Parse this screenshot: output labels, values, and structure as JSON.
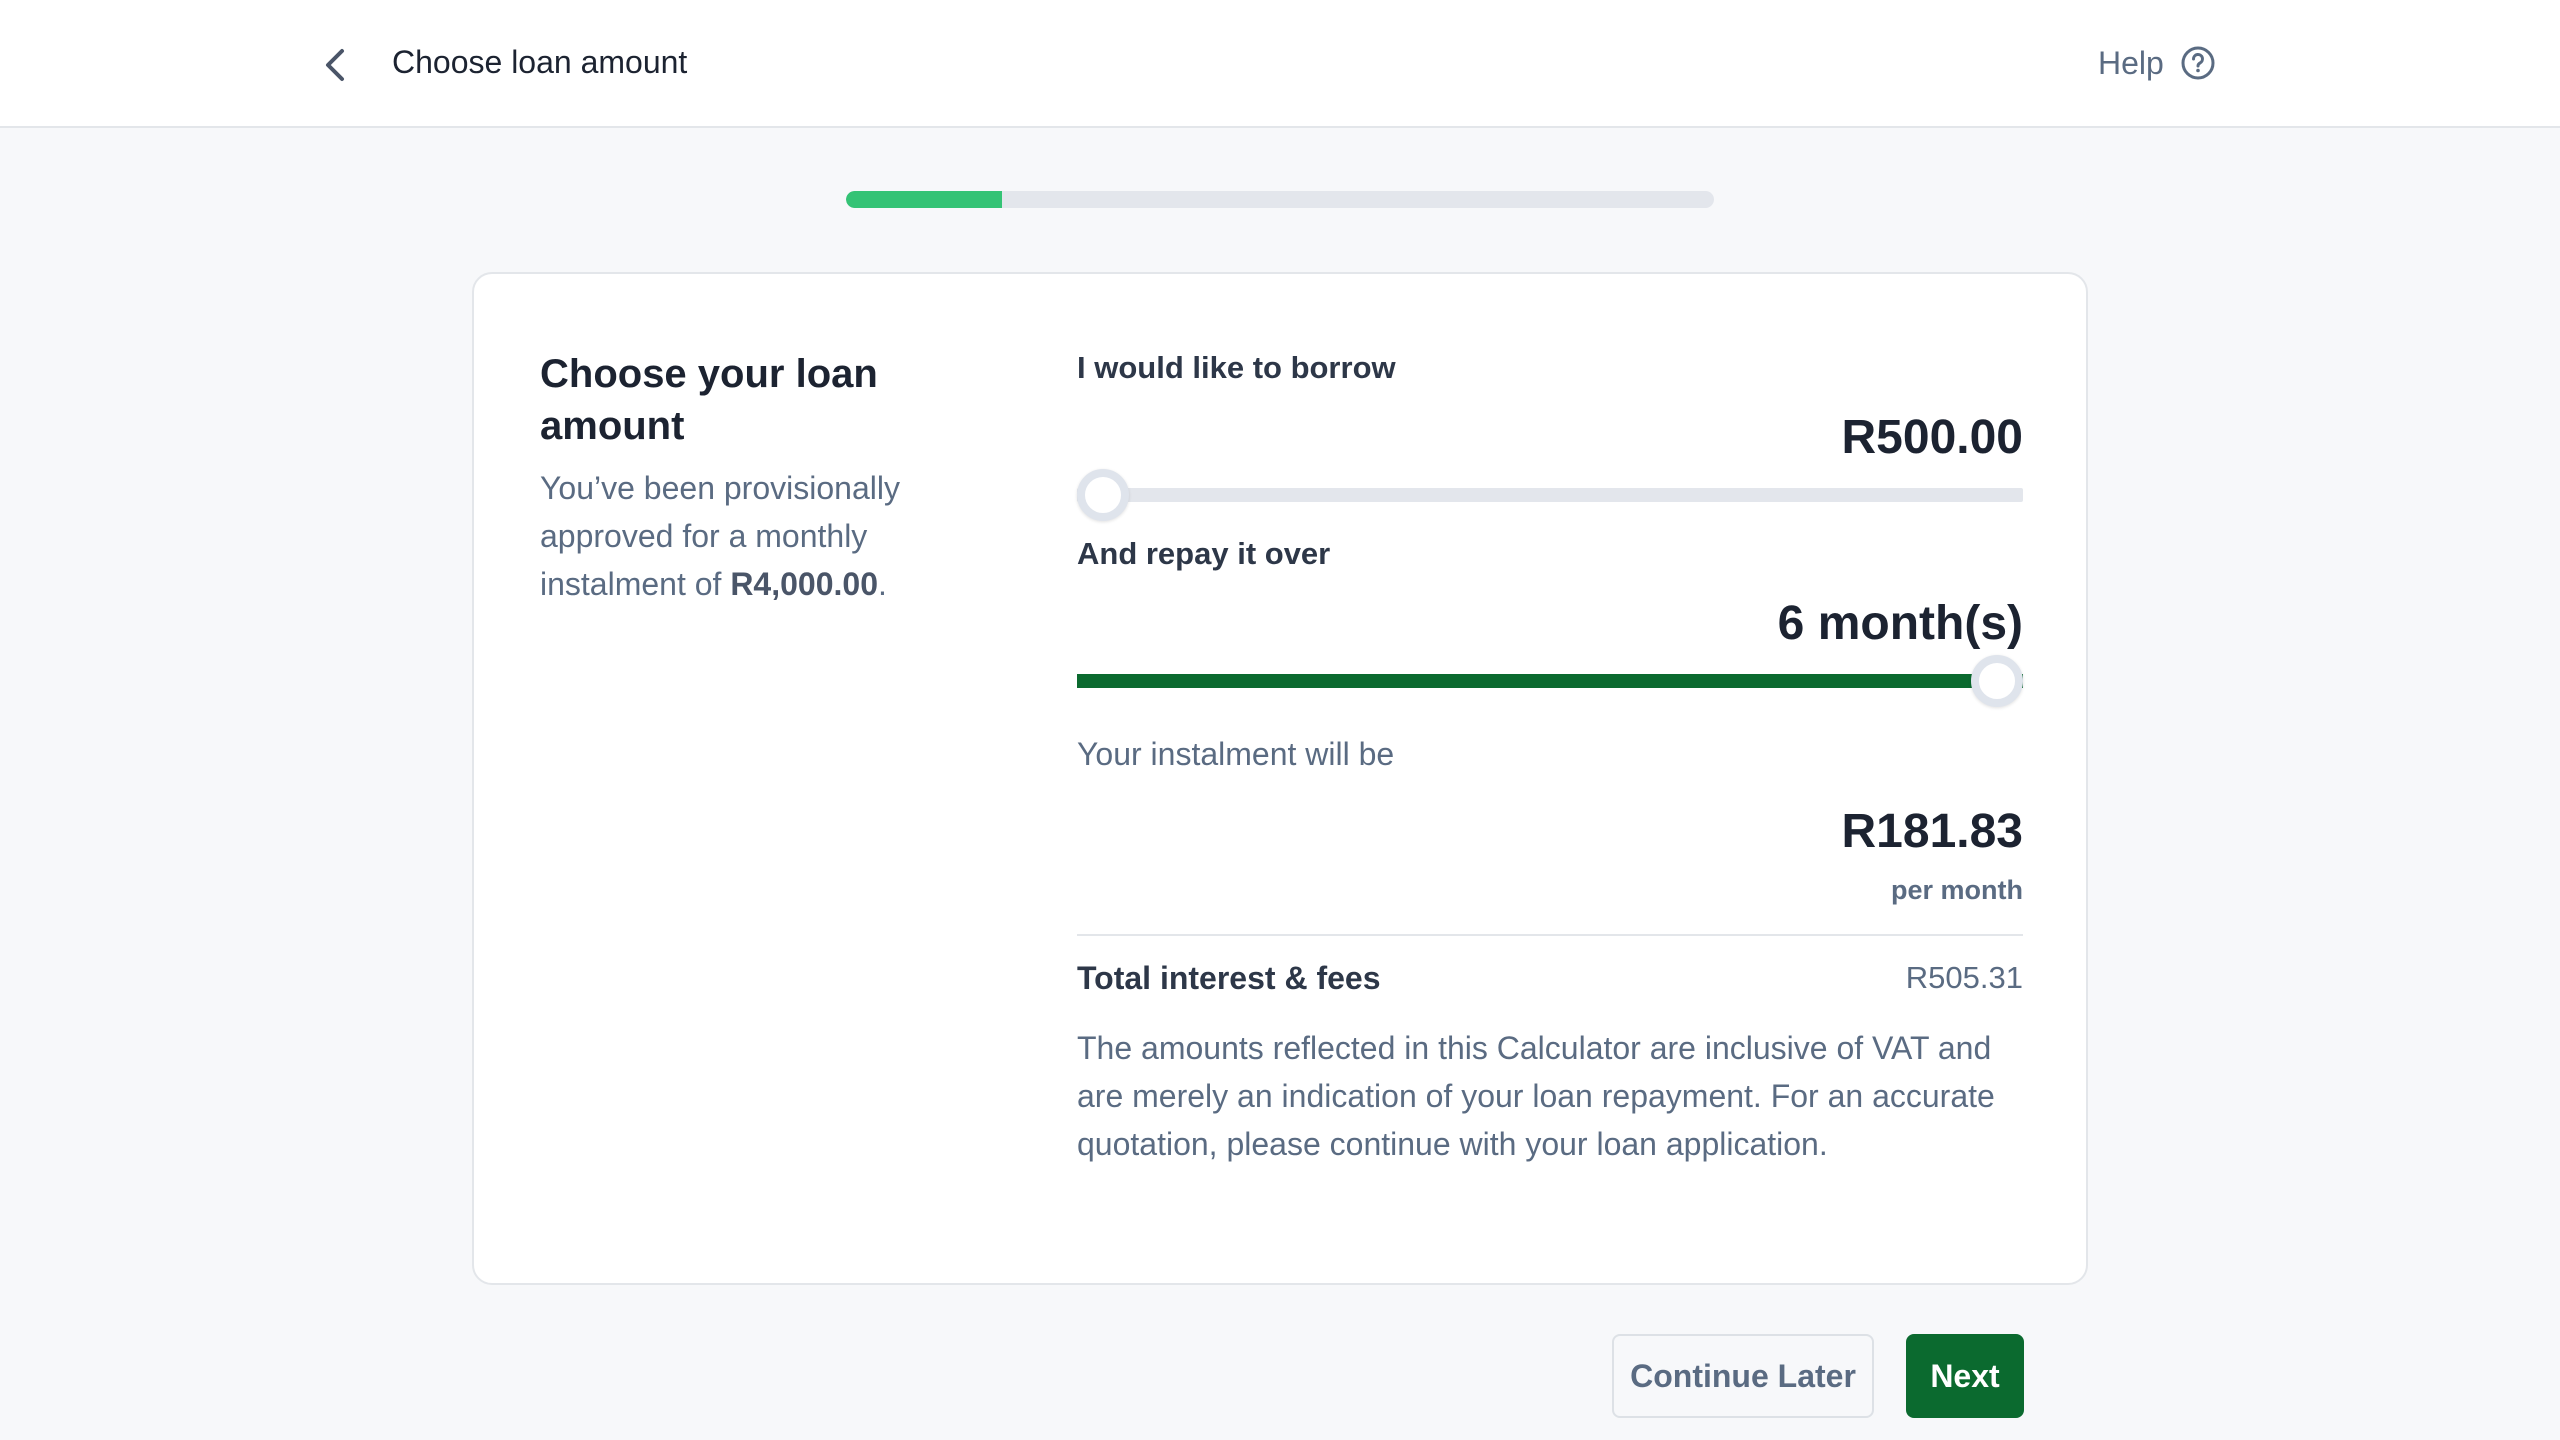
{
  "header": {
    "title": "Choose loan amount",
    "help_label": "Help",
    "back_icon": "chevron-left-icon",
    "help_icon": "question-circle-icon"
  },
  "progress": {
    "value": 0.18,
    "color": "#34c375"
  },
  "left": {
    "title": "Choose your loan amount",
    "description": "You’ve been provisionally approved for a monthly instalment of ",
    "approved_amount": "R4,000.00",
    "description_end": "."
  },
  "loan": {
    "borrow_label": "I would like to borrow",
    "borrow_value": "R500.00",
    "borrow_slider_fraction": 0.0,
    "repay_label": "And repay it over",
    "repay_value": "6 month(s)",
    "repay_slider_fraction": 1.0,
    "instalment_label": "Your instalment will be",
    "instalment_value": "R181.83",
    "per_month": "per month",
    "fees_label": "Total interest & fees",
    "fees_value": "R505.31",
    "disclaimer": "The amounts reflected in this Calculator are inclusive of VAT and are merely an indication of your loan repayment. For an accurate quotation, please continue with your loan application."
  },
  "actions": {
    "continue_later": "Continue Later",
    "next": "Next"
  },
  "colors": {
    "brand_green": "#0b6a2f",
    "progress_green": "#34c375"
  }
}
